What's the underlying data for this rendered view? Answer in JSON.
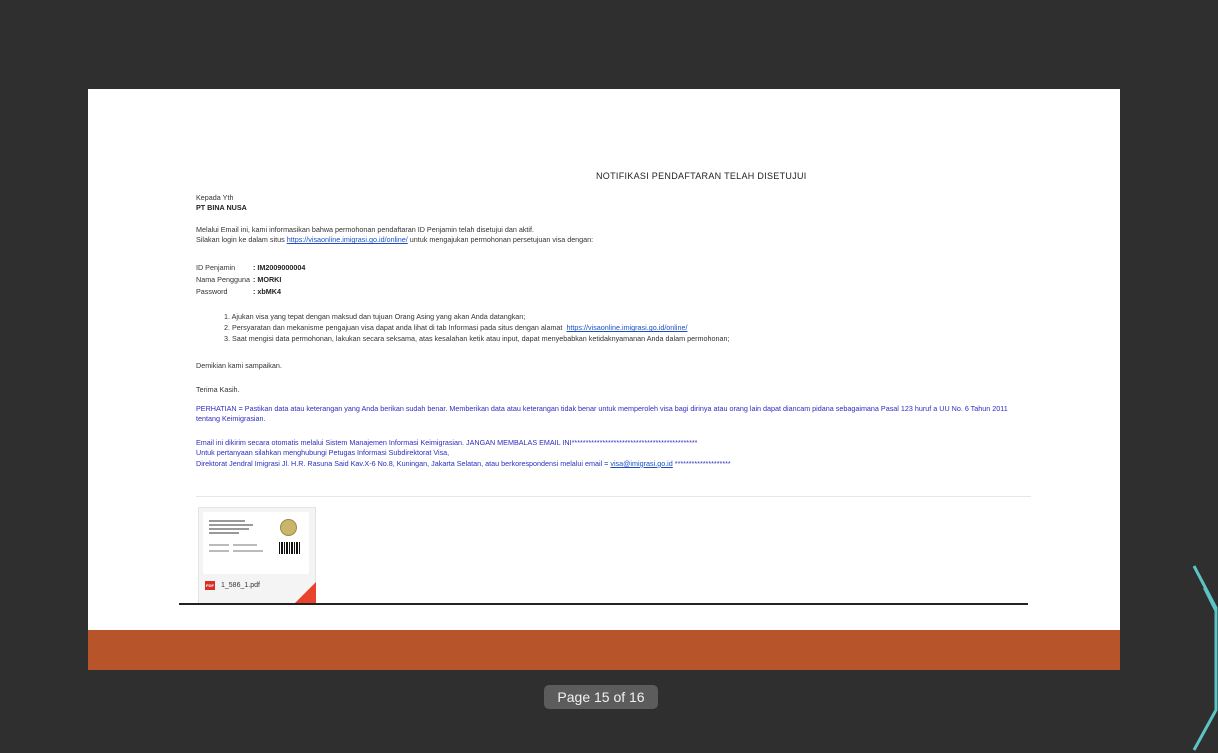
{
  "email": {
    "title": "NOTIFIKASI PENDAFTARAN TELAH DISETUJUI",
    "salutation": "Kepada Yth",
    "recipient": "PT BINA NUSA",
    "intro1": "Melalui Email ini, kami informasikan bahwa permohonan pendaftaran ID Penjamin telah disetujui dan aktif.",
    "intro2_pre": "Silakan login ke dalam situs ",
    "intro2_link": "https://visaonline.imigrasi.go.id/online/",
    "intro2_post": " untuk mengajukan permohonan persetujuan visa dengan:",
    "credentials": [
      {
        "label": "ID Penjamin",
        "value": ": IM2009000004"
      },
      {
        "label": "Nama Pengguna",
        "value": ": MORKI"
      },
      {
        "label": "Password",
        "value": ": xbMK4"
      }
    ],
    "list": [
      "1. Ajukan visa yang tepat dengan maksud dan tujuan Orang Asing yang akan Anda datangkan;",
      "2. Persyaratan dan mekanisme pengajuan visa dapat anda lihat di tab Informasi pada situs dengan alamat",
      "3. Saat mengisi data permohonan, lakukan secara seksama, atas kesalahan ketik atau input, dapat menyebabkan ketidaknyamanan Anda dalam permohonan;"
    ],
    "list_link": "https://visaonline.imigrasi.go.id/online/",
    "closing": "Demikian kami sampaikan.",
    "thanks": "Terima Kasih.",
    "warning": "PERHATIAN = Pastikan data atau keterangan yang Anda berikan sudah benar. Memberikan data atau keterangan tidak benar untuk memperoleh visa bagi dirinya atau orang lain dapat diancam pidana sebagaimana Pasal 123 huruf a UU No. 6 Tahun 2011 tentang Keimigrasian.",
    "auto_line": "Email ini dikirim secara otomatis melalui Sistem Manajemen Informasi Keimigrasian. JANGAN MEMBALAS EMAIL INI*********************************************",
    "contact_line": "Untuk pertanyaan silahkan menghubungi Petugas Informasi Subdirektorat Visa,",
    "address_pre": "Direktorat Jendral Imigrasi Jl. H.R. Rasuna Said Kav.X-6 No.8, Kuningan, Jakarta Selatan, atau berkorespondensi melalui email = ",
    "address_link": "visa@imigrasi.go.id",
    "address_post": " ********************",
    "attachment_name": "1_586_1.pdf",
    "attachment_badge": "PDF"
  },
  "pager": {
    "text": "Page 15 of 16"
  },
  "colors": {
    "background": "#2f2f2f",
    "footer_band": "#b85429",
    "link": "#1a4ec4",
    "notice": "#2d2dc0"
  }
}
